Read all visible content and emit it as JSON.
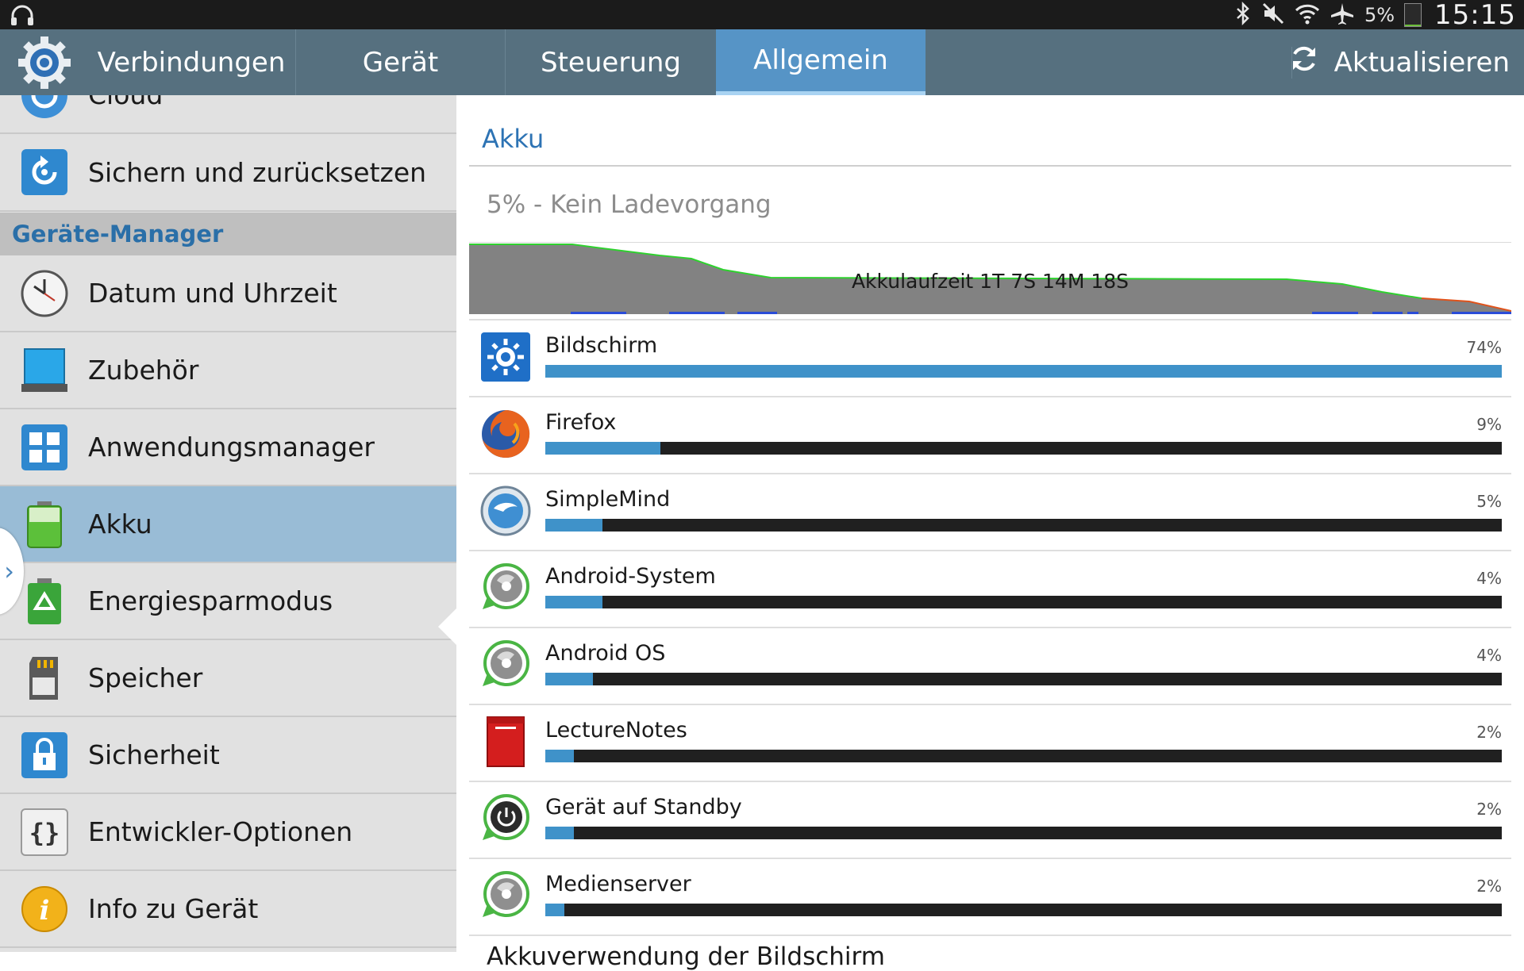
{
  "status_bar": {
    "battery_percent": "5%",
    "time": "15:15",
    "icons": [
      "headphones-icon",
      "bluetooth-icon",
      "mute-icon",
      "wifi-icon",
      "airplane-mode-icon",
      "battery-icon"
    ]
  },
  "action_bar": {
    "tabs": [
      {
        "label": "Verbindungen"
      },
      {
        "label": "Gerät"
      },
      {
        "label": "Steuerung"
      },
      {
        "label": "Allgemein",
        "active": true
      }
    ],
    "refresh_label": "Aktualisieren"
  },
  "sidebar": {
    "partial_item": "Cloud",
    "item_backup": "Sichern und zurücksetzen",
    "section_header": "Geräte-Manager",
    "items": [
      {
        "label": "Datum und Uhrzeit",
        "icon": "clock-icon"
      },
      {
        "label": "Zubehör",
        "icon": "accessory-icon"
      },
      {
        "label": "Anwendungsmanager",
        "icon": "apps-grid-icon"
      },
      {
        "label": "Akku",
        "icon": "battery-icon",
        "active": true
      },
      {
        "label": "Energiesparmodus",
        "icon": "recycle-icon"
      },
      {
        "label": "Speicher",
        "icon": "sd-card-icon"
      },
      {
        "label": "Sicherheit",
        "icon": "lock-icon"
      },
      {
        "label": "Entwickler-Optionen",
        "icon": "braces-icon"
      },
      {
        "label": "Info zu Gerät",
        "icon": "info-icon"
      }
    ],
    "accent_color": "#2a6fa8",
    "active_color": "#99bcd6"
  },
  "main": {
    "title": "Akku",
    "status": "5% - Kein Ladevorgang",
    "graph_label": "Akkulaufzeit 1T 7S 14M 18S",
    "usage": [
      {
        "name": "Bildschirm",
        "percent": "74%",
        "fraction": 1.0,
        "icon": "brightness-icon"
      },
      {
        "name": "Firefox",
        "percent": "9%",
        "fraction": 0.12,
        "icon": "firefox-icon"
      },
      {
        "name": "SimpleMind",
        "percent": "5%",
        "fraction": 0.06,
        "icon": "simplemind-icon"
      },
      {
        "name": "Android-System",
        "percent": "4%",
        "fraction": 0.06,
        "icon": "android-system-icon"
      },
      {
        "name": "Android OS",
        "percent": "4%",
        "fraction": 0.05,
        "icon": "android-os-icon"
      },
      {
        "name": "LectureNotes",
        "percent": "2%",
        "fraction": 0.03,
        "icon": "lecturenotes-icon"
      },
      {
        "name": "Gerät auf Standby",
        "percent": "2%",
        "fraction": 0.03,
        "icon": "power-icon"
      },
      {
        "name": "Medienserver",
        "percent": "2%",
        "fraction": 0.02,
        "icon": "media-server-icon"
      }
    ],
    "bottom_partial_text": "Akkuverwendung der Bildschirm",
    "bar_fill_color": "#3f92c9",
    "title_color": "#2d73b4"
  }
}
